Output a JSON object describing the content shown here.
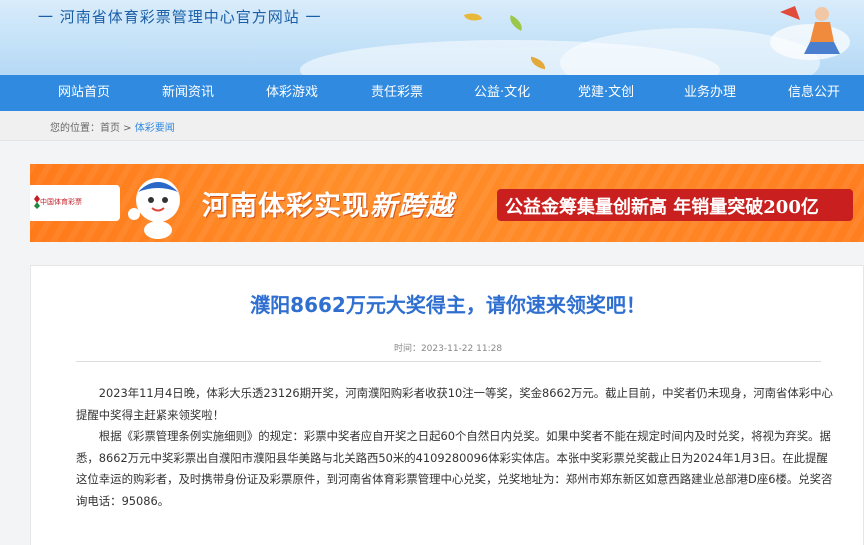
{
  "header": {
    "site_title": "一 河南省体育彩票管理中心官方网站 一"
  },
  "nav": {
    "items": [
      {
        "label": "网站首页"
      },
      {
        "label": "新闻资讯"
      },
      {
        "label": "体彩游戏"
      },
      {
        "label": "责任彩票"
      },
      {
        "label": "公益·文化"
      },
      {
        "label": "党建·文创"
      },
      {
        "label": "业务办理"
      },
      {
        "label": "信息公开"
      }
    ]
  },
  "breadcrumb": {
    "prefix": "您的位置：",
    "home": "首页",
    "separator": " > ",
    "current": "体彩要闻"
  },
  "banner": {
    "logo_text": "中国体育彩票",
    "title_main": "河南体彩实现",
    "title_em": "新跨越",
    "pill_text": "公益金筹集量创新高 年销量突破200亿"
  },
  "article": {
    "title": "濮阳8662万元大奖得主，请你速来领奖吧！",
    "meta_label": "时间：",
    "meta_time": "2023-11-22 11:28",
    "paragraphs": [
      "2023年11月4日晚，体彩大乐透23126期开奖，河南濮阳购彩者收获10注一等奖，奖金8662万元。截止目前，中奖者仍未现身，河南省体彩中心提醒中奖得主赶紧来领奖啦！",
      "根据《彩票管理条例实施细则》的规定：彩票中奖者应自开奖之日起60个自然日内兑奖。如果中奖者不能在规定时间内及时兑奖，将视为弃奖。据悉，8662万元中奖彩票出自濮阳市濮阳县华美路与北关路西50米的4109280096体彩实体店。本张中奖彩票兑奖截止日为2024年1月3日。在此提醒这位幸运的购彩者，及时携带身份证及彩票原件，到河南省体育彩票管理中心兑奖，兑奖地址为：郑州市郑东新区如意西路建业总部港D座6楼。兑奖咨询电话：95086。"
    ]
  },
  "colors": {
    "nav_blue": "#2f8ae0",
    "title_blue": "#2f6fd0",
    "banner_orange": "#ff8f2a",
    "banner_red": "#c9201f"
  }
}
